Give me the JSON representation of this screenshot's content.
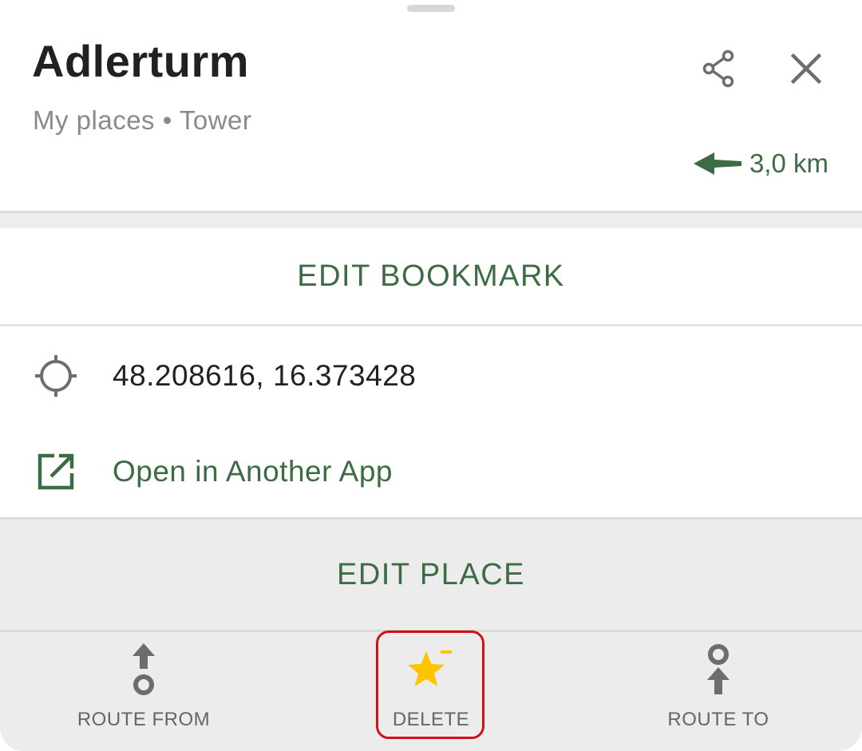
{
  "header": {
    "title": "Adlerturm",
    "subtitle": "My places • Tower",
    "distance": "3,0 km",
    "share_icon": "share-icon",
    "close_icon": "close-icon",
    "direction_icon": "arrow-left-icon"
  },
  "actions": {
    "edit_bookmark": "EDIT BOOKMARK",
    "edit_place": "EDIT PLACE"
  },
  "details": {
    "coordinates": "48.208616, 16.373428",
    "coordinates_icon": "crosshair-icon",
    "open_in_app": "Open in Another App",
    "open_in_app_icon": "external-link-icon"
  },
  "bottom_bar": {
    "route_from": "ROUTE FROM",
    "delete": "DELETE",
    "route_to": "ROUTE TO"
  },
  "colors": {
    "accent_green": "#3d6b44",
    "star_yellow": "#ffc400",
    "highlight_red": "#d10f17",
    "icon_gray": "#6d6d6d"
  }
}
